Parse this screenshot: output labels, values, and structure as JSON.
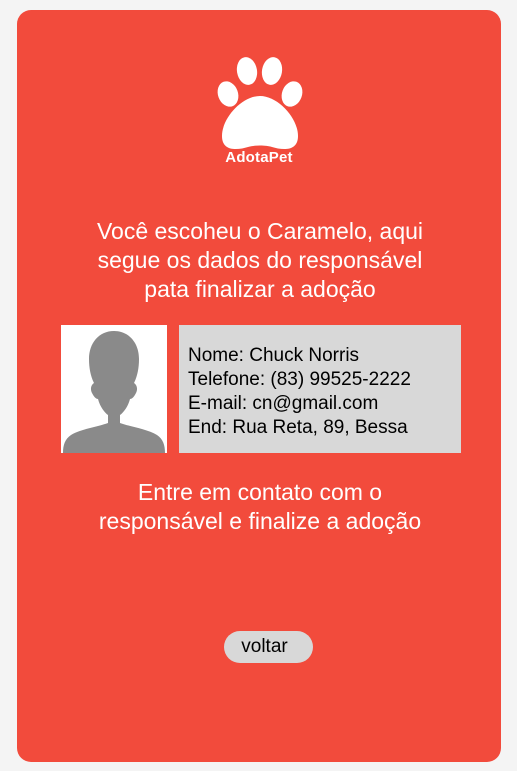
{
  "app": {
    "brand": "AdotaPet",
    "logo_icon": "paw-icon"
  },
  "intro": {
    "line1": "Você escoheu o Caramelo, aqui",
    "line2": "segue os dados do responsável",
    "line3": "pata finalizar a adoção"
  },
  "owner": {
    "avatar_icon": "person-silhouette-icon",
    "name_line": "Nome: Chuck Norris",
    "phone_line": "Telefone: (83) 99525-2222",
    "email_line": "E-mail: cn@gmail.com",
    "address_line": "End: Rua Reta, 89, Bessa"
  },
  "contact": {
    "line1": "Entre em contato com o",
    "line2": "responsável e finalize a adoção"
  },
  "actions": {
    "back_label": "voltar"
  },
  "colors": {
    "card_background": "#f24b3c",
    "page_background": "#f4f4f4",
    "panel_gray": "#d8d8d8",
    "text_light": "#ffffff"
  }
}
